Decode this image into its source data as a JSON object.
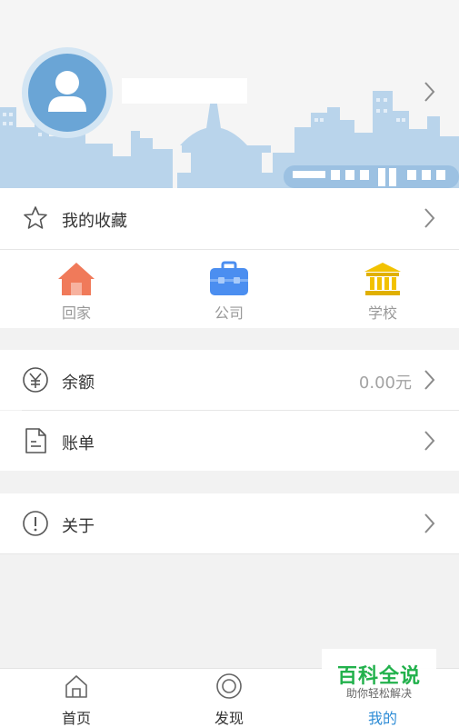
{
  "profile": {
    "username": ""
  },
  "menu": {
    "favorites": {
      "label": "我的收藏",
      "icon": "star-icon"
    },
    "balance": {
      "label": "余额",
      "value": "0.00元",
      "icon": "yen-icon"
    },
    "bill": {
      "label": "账单",
      "icon": "document-icon"
    },
    "about": {
      "label": "关于",
      "icon": "info-icon"
    }
  },
  "quick_links": [
    {
      "label": "回家",
      "icon": "home-icon",
      "color": "#f07a5a"
    },
    {
      "label": "公司",
      "icon": "briefcase-icon",
      "color": "#4b8ef0"
    },
    {
      "label": "学校",
      "icon": "school-icon",
      "color": "#f2c200"
    }
  ],
  "tabs": [
    {
      "label": "首页",
      "icon": "home-outline-icon",
      "active": false
    },
    {
      "label": "发现",
      "icon": "discover-icon",
      "active": false
    },
    {
      "label": "我的",
      "icon": "profile-icon",
      "active": true
    }
  ],
  "watermark": {
    "title": "百科全说",
    "subtitle": "助你轻松解决"
  },
  "colors": {
    "accent": "#2e8cd6",
    "skyline": "#b9d4eb",
    "header_bg": "#f5f5f5"
  }
}
